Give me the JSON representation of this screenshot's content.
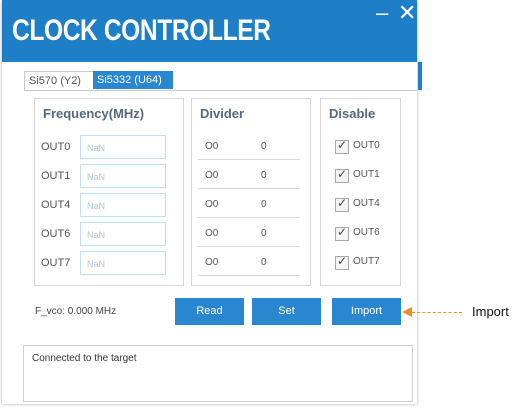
{
  "window": {
    "title": "CLOCK CONTROLLER",
    "minimize_glyph": "–",
    "close_glyph": "✕"
  },
  "tabs": [
    {
      "label": "Si570 (Y2)",
      "active": false
    },
    {
      "label": "Si5332 (U64)",
      "active": true
    }
  ],
  "frequency": {
    "header": "Frequency(MHz)",
    "rows": [
      {
        "label": "OUT0",
        "value": "NaN"
      },
      {
        "label": "OUT1",
        "value": "NaN"
      },
      {
        "label": "OUT4",
        "value": "NaN"
      },
      {
        "label": "OUT6",
        "value": "NaN"
      },
      {
        "label": "OUT7",
        "value": "NaN"
      }
    ]
  },
  "divider": {
    "header": "Divider",
    "rows": [
      {
        "label": "O0",
        "value": "0"
      },
      {
        "label": "O0",
        "value": "0"
      },
      {
        "label": "O0",
        "value": "0"
      },
      {
        "label": "O0",
        "value": "0"
      },
      {
        "label": "O0",
        "value": "0"
      }
    ]
  },
  "disable": {
    "header": "Disable",
    "rows": [
      {
        "label": "OUT0",
        "checked": true
      },
      {
        "label": "OUT1",
        "checked": true
      },
      {
        "label": "OUT4",
        "checked": true
      },
      {
        "label": "OUT6",
        "checked": true
      },
      {
        "label": "OUT7",
        "checked": true
      }
    ],
    "check_glyph": "✓"
  },
  "footer": {
    "fvco": "F_vco:  0.000 MHz",
    "read_label": "Read",
    "set_label": "Set",
    "import_label": "Import"
  },
  "log": {
    "message": "Connected to the target"
  },
  "annotation": {
    "label": "Import"
  },
  "colors": {
    "accent": "#1e7fc6",
    "button": "#2a86cf",
    "callout": "#f08c28"
  }
}
